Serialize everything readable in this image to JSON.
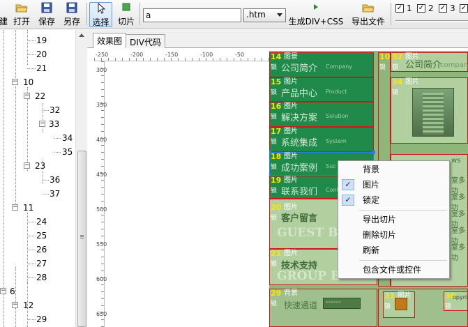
{
  "toolbar": {
    "new_label": "建",
    "open_label": "打开",
    "save_label": "保存",
    "saveas_label": "另存",
    "select_label": "选择",
    "slice_label": "切片",
    "filename_value": "a",
    "extension_value": ".htm",
    "generate_label": "生成DIV+CSS",
    "export_label": "导出文件",
    "checks": [
      {
        "label": "1",
        "checked": true
      },
      {
        "label": "2",
        "checked": true
      },
      {
        "label": "3",
        "checked": true
      },
      {
        "label": "4",
        "checked": true
      }
    ]
  },
  "tree": {
    "nodes": [
      "19",
      "20",
      "21",
      "10",
      "22",
      "32",
      "33",
      "34",
      "35",
      "23",
      "36",
      "37",
      "11",
      "24",
      "25",
      "26",
      "27",
      "28",
      "6",
      "12",
      "29"
    ]
  },
  "tabs": [
    "效果图",
    "DIV代码"
  ],
  "ruler": {
    "h": [
      "-250",
      "-200",
      "-150",
      "-100",
      "-50",
      "0"
    ],
    "v": [
      "300",
      "350",
      "400",
      "450",
      "500",
      "550",
      "600",
      "650"
    ]
  },
  "slices": {
    "s14": {
      "id": "14",
      "type": "图景",
      "lock": "锁",
      "cn": "公司简介",
      "en": "Company"
    },
    "s15": {
      "id": "15",
      "type": "图片",
      "lock": "锁",
      "cn": "产品中心",
      "en": "Product"
    },
    "s16": {
      "id": "16",
      "type": "图片",
      "lock": "锁",
      "cn": "解决方案",
      "en": "Solution"
    },
    "s17": {
      "id": "17",
      "type": "图片",
      "lock": "锁",
      "cn": "系统集成",
      "en": "System"
    },
    "s18": {
      "id": "18",
      "type": "图片",
      "lock": "锁",
      "cn": "成功案例",
      "en": "Suc"
    },
    "s19": {
      "id": "19",
      "type": "图片",
      "lock": "锁",
      "cn": "联系我们",
      "en": "Cont"
    },
    "s20": {
      "id": "20",
      "type": "图片",
      "lock": "锁",
      "cn": "客户留言",
      "en": "GUEST BO"
    },
    "s21": {
      "id": "21",
      "type": "图片",
      "lock": "锁",
      "cn": "技术支持",
      "en": "GROUP B"
    },
    "s29": {
      "id": "29",
      "type": "背景",
      "lock": "锁",
      "cn": "快速通道",
      "en": "------"
    },
    "s10": {
      "id": "10",
      "type": "图片",
      "lock": "锁"
    },
    "s32": {
      "id": "32",
      "type": "图片",
      "lock": "锁",
      "cn": "公司简介",
      "en": "compan"
    },
    "s34": {
      "id": "34",
      "type": "图片",
      "lock": "锁"
    },
    "s35": {
      "id": "35",
      "type": "图片",
      "lock": "锁",
      "en": "ws"
    },
    "s31": {
      "id": "31",
      "type": "图片",
      "lock": "锁"
    },
    "s30": {
      "id": "30",
      "type": "",
      "lock": "锁",
      "en": "opyrigh"
    },
    "side_texts": [
      "室多功",
      "室多功",
      "室多功",
      "室多功",
      "室多功"
    ]
  },
  "context_menu": {
    "items": [
      {
        "label": "背景",
        "checked": false
      },
      {
        "label": "图片",
        "checked": true
      },
      {
        "label": "锁定",
        "checked": true
      },
      {
        "label": "导出切片",
        "checked": false
      },
      {
        "label": "删除切片",
        "checked": false
      },
      {
        "label": "刷新",
        "checked": false
      },
      {
        "label": "包含文件或控件",
        "checked": false
      }
    ]
  },
  "colors": {
    "selection": "#2a7ef3",
    "slice_border": "#cc1818",
    "slice_green": "#1f8a4a",
    "label_yellow": "#ffe600"
  }
}
